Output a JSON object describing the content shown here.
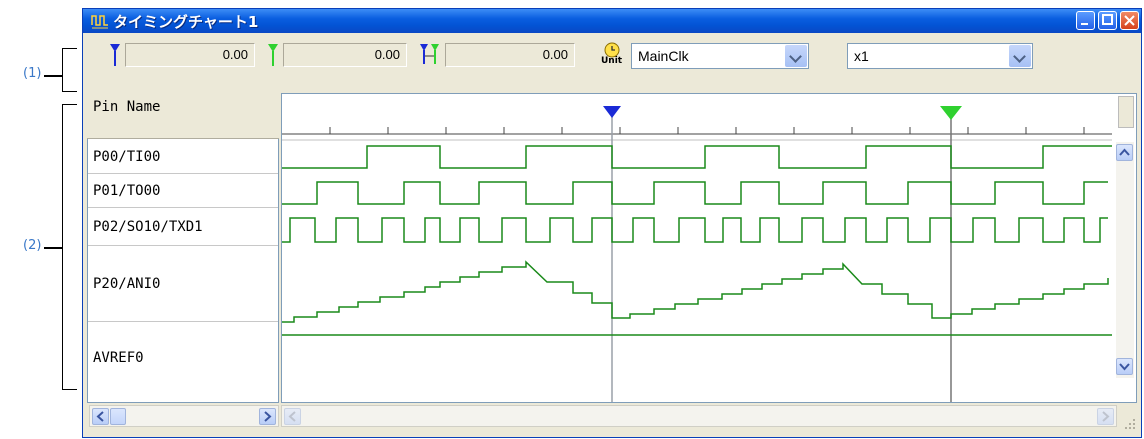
{
  "window": {
    "title": "タイミングチャート1"
  },
  "callouts": {
    "toolbar": "(1)",
    "panes": "(2)"
  },
  "toolbar": {
    "marker1_value": "0.00",
    "marker2_value": "0.00",
    "diff_value": "0.00",
    "clock_select": "MainClk",
    "zoom_select": "x1",
    "unit_icon_label": "Unit"
  },
  "pin_header": "Pin Name",
  "pins": [
    {
      "name": "P00/TI00"
    },
    {
      "name": "P01/TO00"
    },
    {
      "name": "P02/SO10/TXD1"
    },
    {
      "name": "P20/ANI0"
    },
    {
      "name": "AVREF0"
    }
  ],
  "colors": {
    "wave": "#1a8a1a",
    "marker1": "#1a2ad6",
    "marker2": "#2fd12f"
  }
}
